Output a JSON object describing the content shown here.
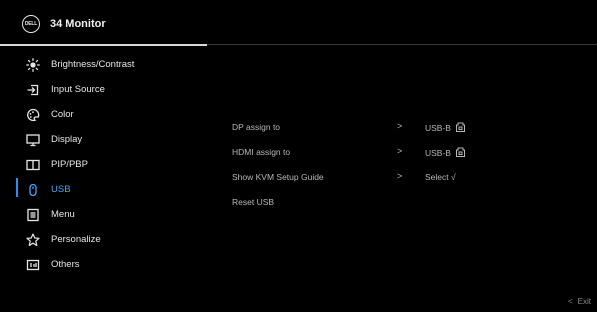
{
  "header": {
    "logo_text": "DELL",
    "title": "34 Monitor"
  },
  "menu": {
    "items": [
      {
        "label": "Brightness/Contrast",
        "icon": "brightness-icon"
      },
      {
        "label": "Input Source",
        "icon": "input-source-icon"
      },
      {
        "label": "Color",
        "icon": "color-icon"
      },
      {
        "label": "Display",
        "icon": "display-icon"
      },
      {
        "label": "PIP/PBP",
        "icon": "pip-pbp-icon"
      },
      {
        "label": "USB",
        "icon": "usb-icon",
        "active": true
      },
      {
        "label": "Menu",
        "icon": "menu-icon"
      },
      {
        "label": "Personalize",
        "icon": "star-icon"
      },
      {
        "label": "Others",
        "icon": "others-icon"
      }
    ]
  },
  "usb_settings": {
    "rows": [
      {
        "label": "DP assign to",
        "chevron": ">",
        "value": "USB-B",
        "value_icon": "usb-b-port-icon"
      },
      {
        "label": "HDMI assign to",
        "chevron": ">",
        "value": "USB-B",
        "value_icon": "usb-b-port-icon"
      },
      {
        "label": "Show KVM Setup Guide",
        "chevron": ">",
        "value": "Select √"
      },
      {
        "label": "Reset USB"
      }
    ]
  },
  "footer": {
    "exit_chevron": "<",
    "exit_label": "Exit"
  },
  "colors": {
    "background": "#000000",
    "accent": "#2f8cf0",
    "active_text": "#4aa3ff",
    "text": "#e6e6e6",
    "dim_text": "#b8b8b8"
  }
}
